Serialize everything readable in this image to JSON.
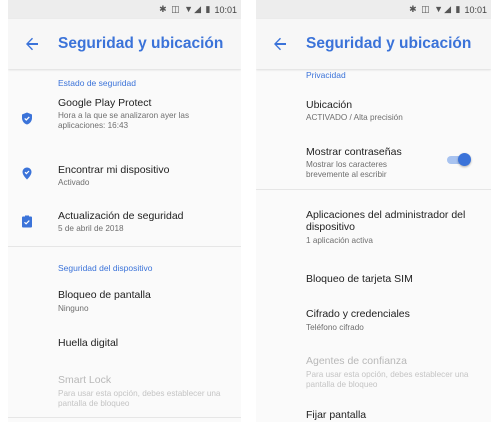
{
  "left": {
    "status_time": "10:01",
    "title": "Seguridad y ubicación",
    "section_security_status": "Estado de seguridad",
    "play_protect": {
      "title": "Google Play Protect",
      "subtitle": "Hora a la que se analizaron ayer las aplicaciones: 16:43"
    },
    "find_device": {
      "title": "Encontrar mi dispositivo",
      "subtitle": "Activado"
    },
    "security_update": {
      "title": "Actualización de seguridad",
      "subtitle": "5 de abril de 2018"
    },
    "section_device_security": "Seguridad del dispositivo",
    "screen_lock": {
      "title": "Bloqueo de pantalla",
      "subtitle": "Ninguno"
    },
    "fingerprint": {
      "title": "Huella digital"
    },
    "smart_lock": {
      "title": "Smart Lock",
      "subtitle": "Para usar esta opción, debes establecer una pantalla de bloqueo"
    }
  },
  "right": {
    "status_time": "10:01",
    "title": "Seguridad y ubicación",
    "section_privacy": "Privacidad",
    "location": {
      "title": "Ubicación",
      "subtitle": "ACTIVADO / Alta precisión"
    },
    "show_passwords": {
      "title": "Mostrar contraseñas",
      "subtitle": "Mostrar los caracteres brevemente al escribir",
      "enabled": true
    },
    "device_admin": {
      "title": "Aplicaciones del administrador del dispositivo",
      "subtitle": "1 aplicación activa"
    },
    "sim_lock": {
      "title": "Bloqueo de tarjeta SIM"
    },
    "encryption": {
      "title": "Cifrado y credenciales",
      "subtitle": "Teléfono cifrado"
    },
    "trust_agents": {
      "title": "Agentes de confianza",
      "subtitle": "Para usar esta opción, debes establecer una pantalla de bloqueo"
    },
    "screen_pin": {
      "title": "Fijar pantalla"
    }
  },
  "colors": {
    "accent": "#3b73d9",
    "statusbar": "#ededed",
    "background": "#fafafa"
  },
  "icons": [
    "back-arrow-icon",
    "shield-icon",
    "location-pin-icon",
    "security-update-icon",
    "bluetooth-icon",
    "vibrate-icon",
    "wifi-icon",
    "signal-icon",
    "battery-icon"
  ]
}
